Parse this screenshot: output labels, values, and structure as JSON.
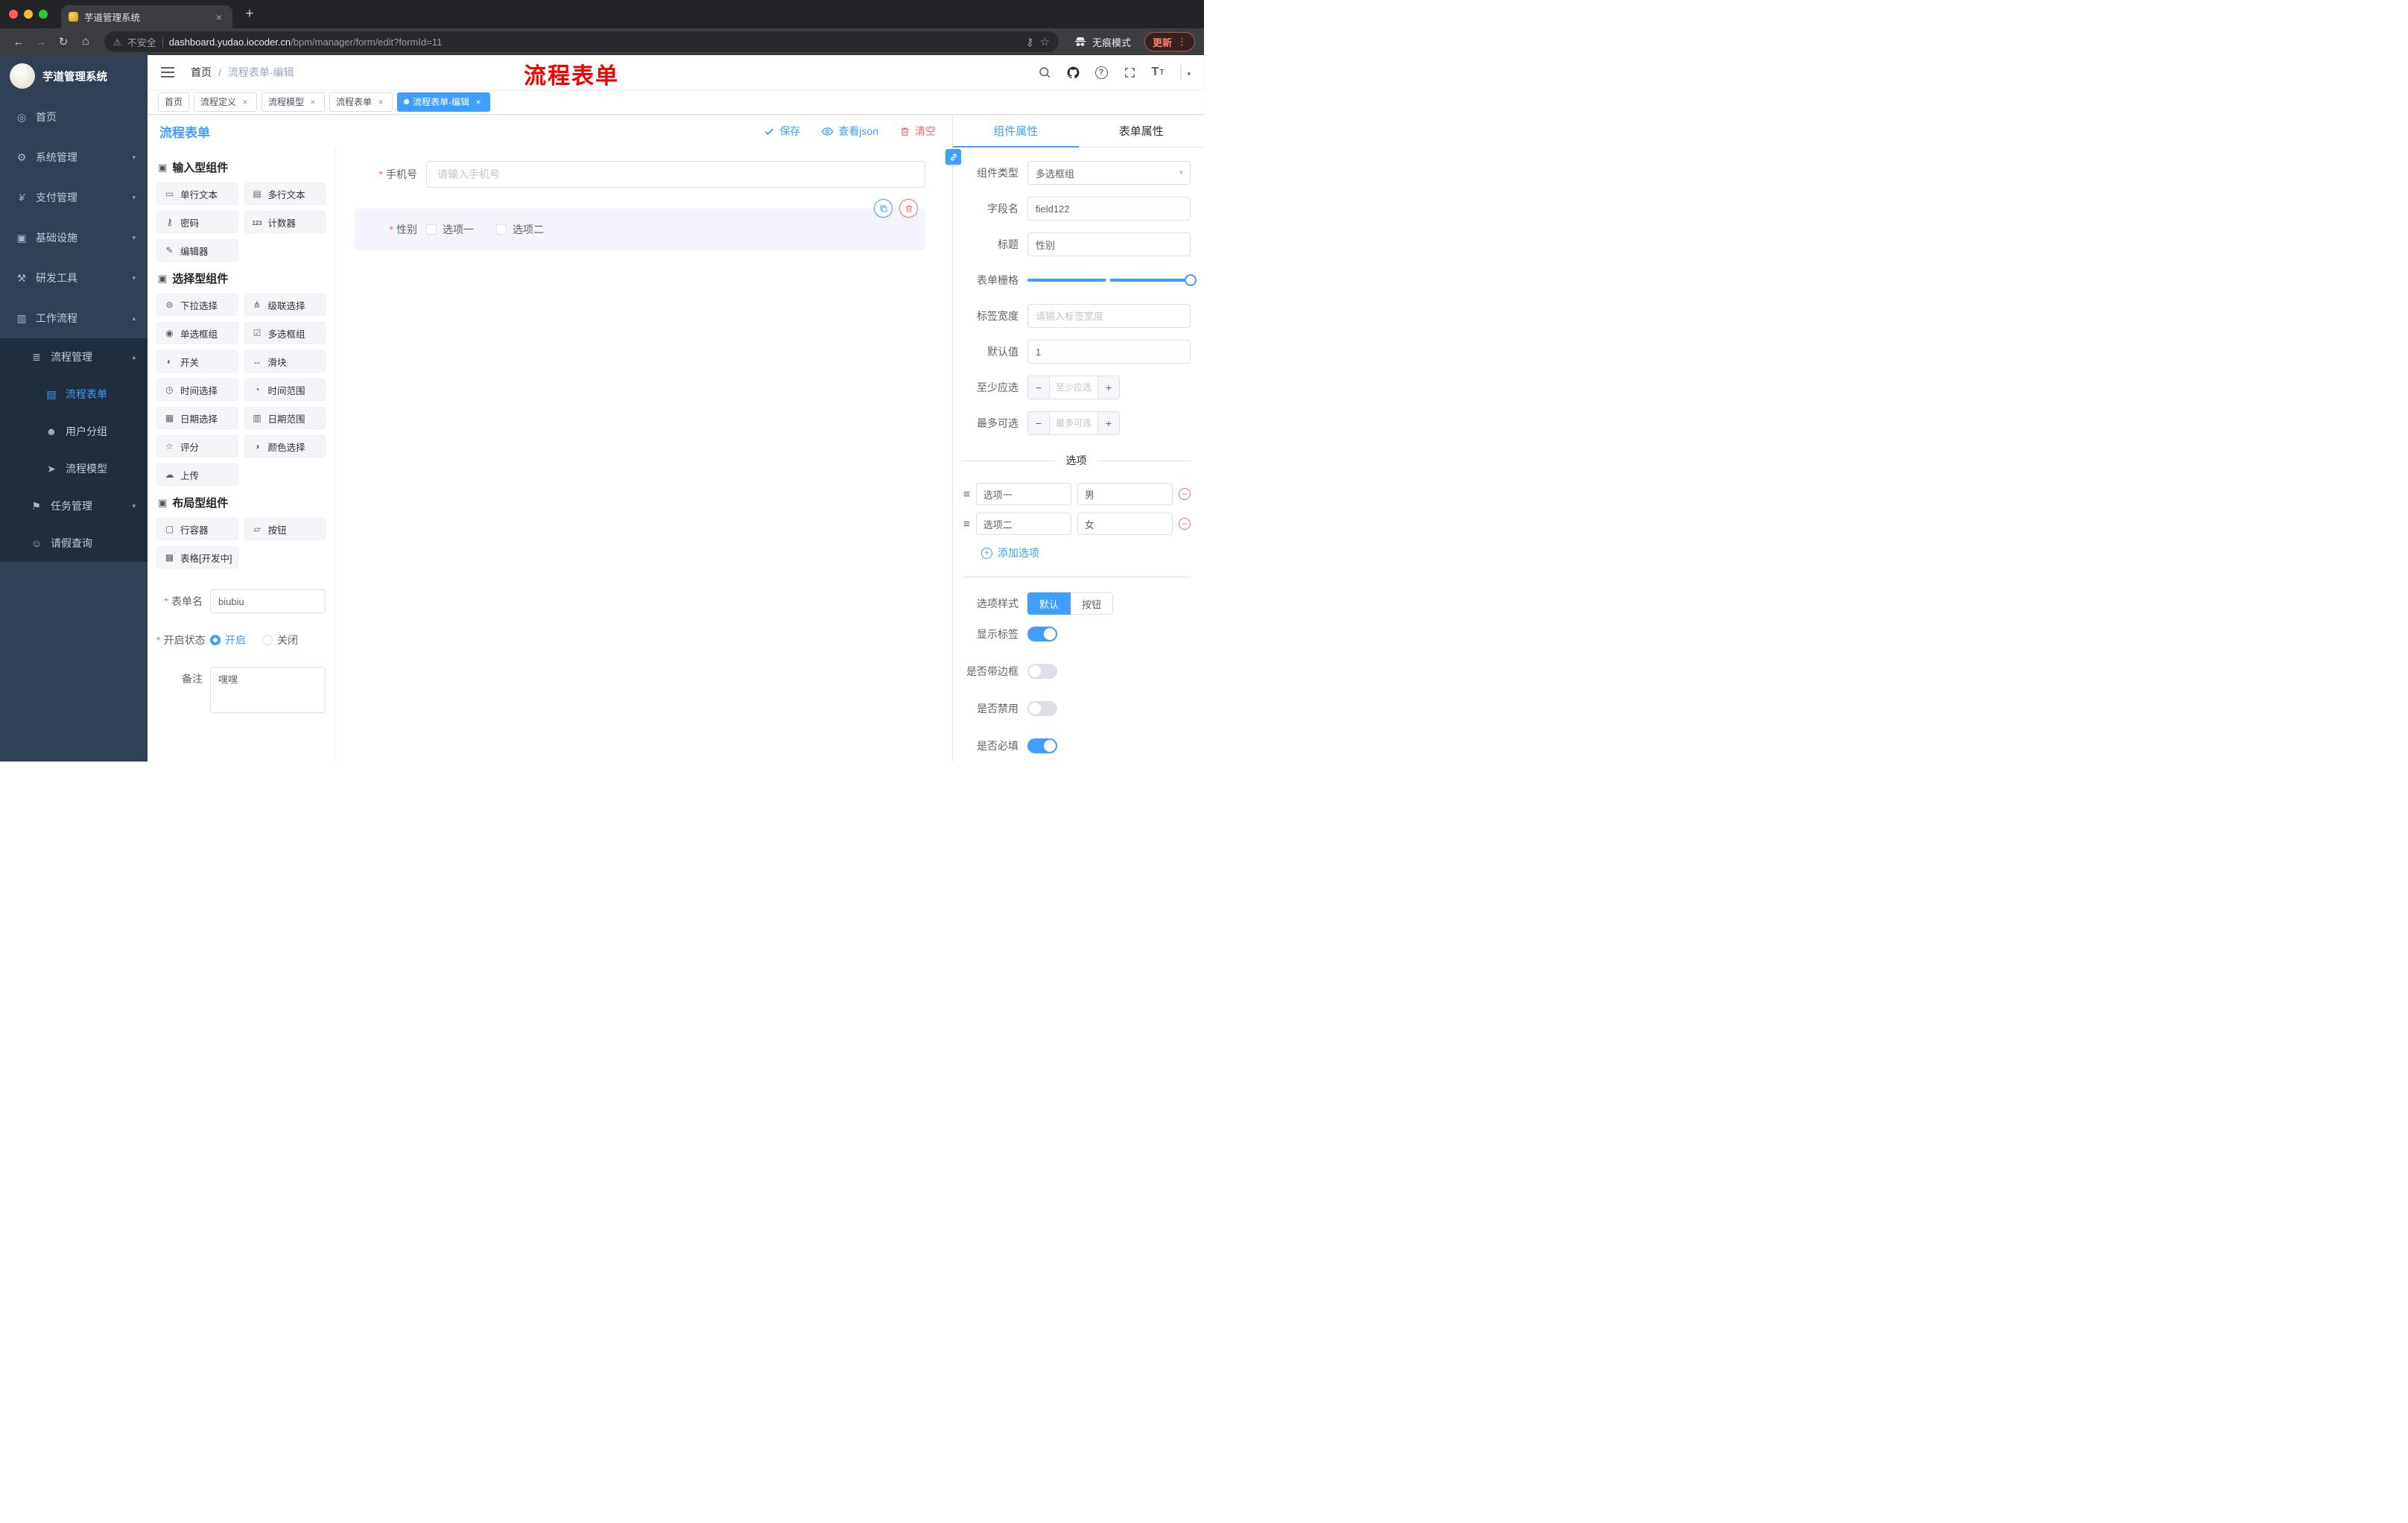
{
  "colors": {
    "accent": "#409eff",
    "danger": "#f56c6c",
    "sidebar_bg": "#304156",
    "sidebar_submenu_bg": "#1f2d3d",
    "annotation_red": "#f40000",
    "active_tag": "#409eff"
  },
  "browser": {
    "tab_title": "芋道管理系统",
    "security_label": "不安全",
    "url_host": "dashboard.yudao.iocoder.cn",
    "url_path": "/bpm/manager/form/edit?formId=11",
    "incognito_label": "无痕模式",
    "update_label": "更新",
    "icons": [
      "back-icon",
      "forward-icon",
      "reload-icon",
      "home-icon",
      "warning-icon",
      "key-icon",
      "bookmark-star-icon",
      "incognito-icon",
      "three-dot-menu-icon"
    ]
  },
  "sidebar": {
    "brand": "芋道管理系统",
    "menu": [
      {
        "label": "首页",
        "icon": "dashboard-icon"
      },
      {
        "label": "系统管理",
        "icon": "gear-icon"
      },
      {
        "label": "支付管理",
        "icon": "yen-icon"
      },
      {
        "label": "基础设施",
        "icon": "monitor-icon"
      },
      {
        "label": "研发工具",
        "icon": "tools-icon"
      },
      {
        "label": "工作流程",
        "icon": "workflow-icon"
      },
      {
        "label": "流程管理",
        "icon": "process-list-icon"
      },
      {
        "label": "流程表单",
        "icon": "form-icon"
      },
      {
        "label": "用户分组",
        "icon": "user-group-icon"
      },
      {
        "label": "流程模型",
        "icon": "send-icon"
      },
      {
        "label": "任务管理",
        "icon": "task-icon"
      },
      {
        "label": "请假查询",
        "icon": "person-icon"
      }
    ]
  },
  "header": {
    "breadcrumb_home": "首页",
    "breadcrumb_separator": "/",
    "breadcrumb_current": "流程表单-编辑",
    "annotation": "流程表单",
    "icons": [
      "search-icon",
      "github-icon",
      "help-icon",
      "fullscreen-icon",
      "font-size-icon",
      "avatar"
    ]
  },
  "tags": [
    {
      "label": "首页",
      "closable": false,
      "active": false
    },
    {
      "label": "流程定义",
      "closable": true,
      "active": false
    },
    {
      "label": "流程模型",
      "closable": true,
      "active": false
    },
    {
      "label": "流程表单",
      "closable": true,
      "active": false
    },
    {
      "label": "流程表单-编辑",
      "closable": true,
      "active": true
    }
  ],
  "designer": {
    "title": "流程表单",
    "save_label": "保存",
    "view_json_label": "查看json",
    "clear_label": "清空"
  },
  "palette": {
    "groups": [
      {
        "title": "输入型组件",
        "items": [
          {
            "label": "单行文本",
            "icon": "single-line-text-icon"
          },
          {
            "label": "多行文本",
            "icon": "textarea-icon"
          },
          {
            "label": "密码",
            "icon": "password-icon"
          },
          {
            "label": "计数器",
            "icon": "counter-icon"
          },
          {
            "label": "编辑器",
            "icon": "editor-icon"
          }
        ]
      },
      {
        "title": "选择型组件",
        "items": [
          {
            "label": "下拉选择",
            "icon": "select-icon"
          },
          {
            "label": "级联选择",
            "icon": "cascader-icon"
          },
          {
            "label": "单选框组",
            "icon": "radio-group-icon"
          },
          {
            "label": "多选框组",
            "icon": "checkbox-group-icon"
          },
          {
            "label": "开关",
            "icon": "switch-icon"
          },
          {
            "label": "滑块",
            "icon": "slider-icon"
          },
          {
            "label": "时间选择",
            "icon": "time-picker-icon"
          },
          {
            "label": "时间范围",
            "icon": "time-range-icon"
          },
          {
            "label": "日期选择",
            "icon": "date-picker-icon"
          },
          {
            "label": "日期范围",
            "icon": "date-range-icon"
          },
          {
            "label": "评分",
            "icon": "rate-icon"
          },
          {
            "label": "颜色选择",
            "icon": "color-picker-icon"
          },
          {
            "label": "上传",
            "icon": "upload-icon"
          }
        ]
      },
      {
        "title": "布局型组件",
        "items": [
          {
            "label": "行容器",
            "icon": "row-container-icon"
          },
          {
            "label": "按钮",
            "icon": "button-icon"
          },
          {
            "label": "表格[开发中]",
            "icon": "table-icon"
          }
        ]
      }
    ],
    "meta": {
      "name_label": "表单名",
      "name_value": "biubiu",
      "status_label": "开启状态",
      "status_on": "开启",
      "status_off": "关闭",
      "status_selected": "开启",
      "remark_label": "备注",
      "remark_value": "嘿嘿"
    }
  },
  "canvas": {
    "phone_label": "手机号",
    "phone_placeholder": "请输入手机号",
    "gender_label": "性别",
    "gender_options": [
      "选项一",
      "选项二"
    ],
    "selected_component": "性别"
  },
  "properties": {
    "tabs": [
      {
        "label": "组件属性",
        "active": true
      },
      {
        "label": "表单属性",
        "active": false
      }
    ],
    "component_type_label": "组件类型",
    "component_type_value": "多选框组",
    "field_name_label": "字段名",
    "field_name_value": "field122",
    "title_label": "标题",
    "title_value": "性别",
    "grid_label": "表单栅格",
    "label_width_label": "标签宽度",
    "label_width_placeholder": "请输入标签宽度",
    "default_label": "默认值",
    "default_value": "1",
    "min_select_label": "至少应选",
    "min_select_placeholder": "至少应选",
    "max_select_label": "最多可选",
    "max_select_placeholder": "最多可选",
    "options_title": "选项",
    "options": [
      {
        "label": "选项一",
        "value": "男"
      },
      {
        "label": "选项二",
        "value": "女"
      }
    ],
    "add_option_label": "添加选项",
    "style_label": "选项样式",
    "style_options": [
      {
        "label": "默认",
        "active": true
      },
      {
        "label": "按钮",
        "active": false
      }
    ],
    "switches": [
      {
        "label": "显示标签",
        "on": true
      },
      {
        "label": "是否带边框",
        "on": false
      },
      {
        "label": "是否禁用",
        "on": false
      },
      {
        "label": "是否必填",
        "on": true
      }
    ]
  }
}
